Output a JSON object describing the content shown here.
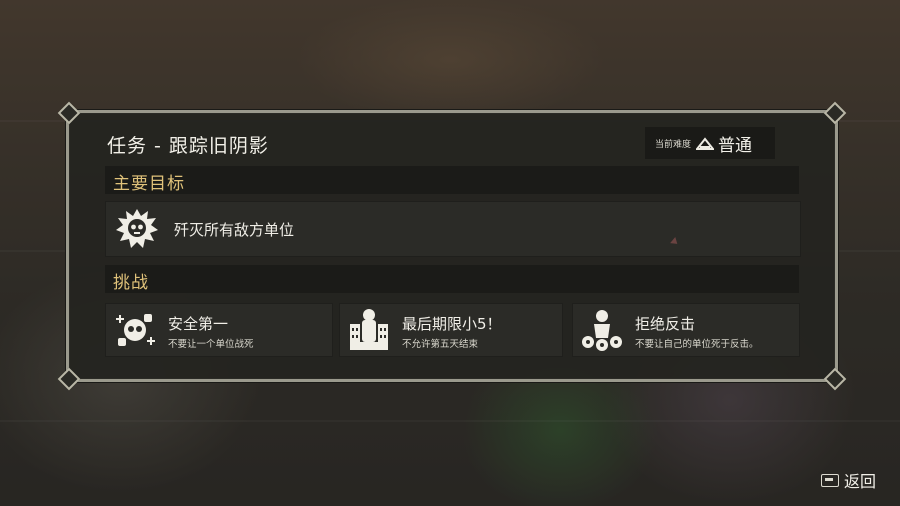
{
  "mission": {
    "title": "任务 - 跟踪旧阴影"
  },
  "difficulty": {
    "label": "当前难度",
    "value": "普通",
    "icon": "difficulty-icon"
  },
  "primary": {
    "heading": "主要目标",
    "objective": "歼灭所有敌方单位",
    "icon": "enemy-skull-icon"
  },
  "challenges": {
    "heading": "挑战",
    "items": [
      {
        "title": "安全第一",
        "desc": "不要让一个单位战死",
        "icon": "safety-icon"
      },
      {
        "title": "最后期限小5！",
        "desc": "不允许第五天结束",
        "icon": "deadline-icon"
      },
      {
        "title": "拒绝反击",
        "desc": "不要让自己的单位死于反击。",
        "icon": "no-counter-icon"
      }
    ]
  },
  "footer": {
    "back_label": "返回",
    "back_icon": "keyboard-key-icon"
  },
  "colors": {
    "accent": "#e0c27a",
    "panel": "#242420",
    "border": "#9b9a8d"
  }
}
